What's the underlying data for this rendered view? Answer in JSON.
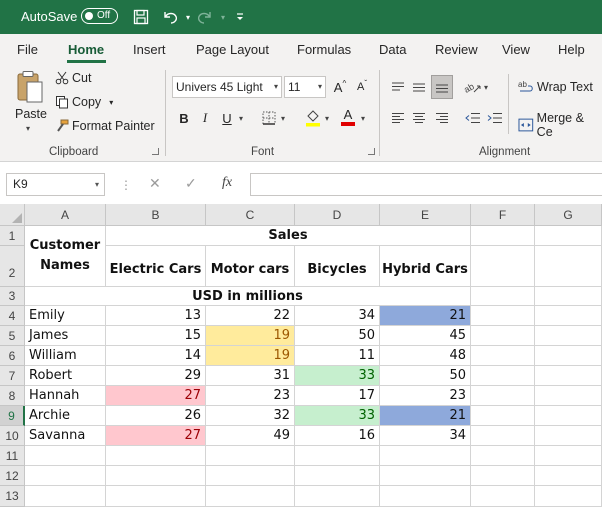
{
  "titlebar": {
    "autosave_label": "AutoSave",
    "autosave_state": "Off",
    "accent_color": "#217346"
  },
  "tabs": [
    {
      "label": "File"
    },
    {
      "label": "Home",
      "active": true
    },
    {
      "label": "Insert"
    },
    {
      "label": "Page Layout"
    },
    {
      "label": "Formulas"
    },
    {
      "label": "Data"
    },
    {
      "label": "Review"
    },
    {
      "label": "View"
    },
    {
      "label": "Help"
    }
  ],
  "ribbon": {
    "clipboard": {
      "group_label": "Clipboard",
      "paste": "Paste",
      "cut": "Cut",
      "copy": "Copy",
      "format_painter": "Format Painter"
    },
    "font": {
      "group_label": "Font",
      "font_name": "Univers 45 Light",
      "font_size": "11",
      "bold": "B",
      "italic": "I",
      "underline": "U",
      "grow": "A",
      "shrink": "A",
      "font_color": "A"
    },
    "alignment": {
      "group_label": "Alignment",
      "wrap_text": "Wrap Text",
      "merge_center": "Merge & Ce"
    }
  },
  "formula_bar": {
    "name_box": "K9",
    "fx": "fx",
    "cancel": "✕",
    "enter": "✓",
    "dots": "⋮",
    "value": ""
  },
  "sheet": {
    "columns": [
      "A",
      "B",
      "C",
      "D",
      "E",
      "F",
      "G"
    ],
    "rows": [
      "1",
      "2",
      "3",
      "4",
      "5",
      "6",
      "7",
      "8",
      "9",
      "10",
      "11",
      "12",
      "13"
    ],
    "selected_row": "9",
    "header": {
      "customer_names": "Customer Names",
      "sales": "Sales",
      "electric_cars": "Electric Cars",
      "motor_cars": "Motor cars",
      "bicycles": "Bicycles",
      "hybrid_cars": "Hybrid Cars",
      "units": "USD in millions"
    },
    "data": [
      {
        "name": "Emily",
        "electric": "13",
        "motor": "22",
        "bicycles": "34",
        "hybrid": "21"
      },
      {
        "name": "James",
        "electric": "15",
        "motor": "19",
        "bicycles": "50",
        "hybrid": "45"
      },
      {
        "name": "William",
        "electric": "14",
        "motor": "19",
        "bicycles": "11",
        "hybrid": "48"
      },
      {
        "name": "Robert",
        "electric": "29",
        "motor": "31",
        "bicycles": "33",
        "hybrid": "50"
      },
      {
        "name": "Hannah",
        "electric": "27",
        "motor": "23",
        "bicycles": "17",
        "hybrid": "23"
      },
      {
        "name": "Archie",
        "electric": "26",
        "motor": "32",
        "bicycles": "33",
        "hybrid": "21"
      },
      {
        "name": "Savanna",
        "electric": "27",
        "motor": "49",
        "bicycles": "16",
        "hybrid": "34"
      }
    ],
    "highlight_colors": {
      "blue": "#8ea9db",
      "yellow": "#ffeb9c",
      "green": "#c6efce",
      "red": "#ffc7ce"
    }
  }
}
